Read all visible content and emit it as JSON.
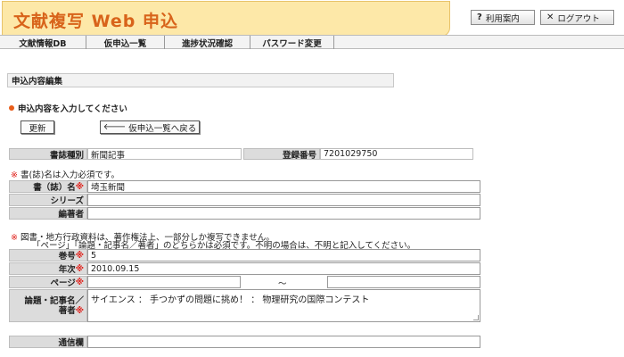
{
  "header": {
    "title": "文献複写 Web 申込"
  },
  "top_buttons": {
    "help": "利用案内",
    "logout": "ログアウト"
  },
  "menu": [
    "文献情報DB",
    "仮申込一覧",
    "進捗状況確認",
    "パスワード変更"
  ],
  "section_title": "申込内容編集",
  "instruction": "申込内容を入力してください",
  "buttons": {
    "update": "更新",
    "back": "仮申込一覧へ戻る"
  },
  "info": {
    "doc_type_label": "書誌種別",
    "doc_type_value": "新聞記事",
    "reg_no_label": "登録番号",
    "reg_no_value": "7201029750"
  },
  "notes": {
    "mark": "※",
    "required_title": "書(誌)名は入力必須です。",
    "copyright_1": "図書・地方行政資料は、著作権法上、一部分しか複写できません。",
    "copyright_2": "「ページ」「論題・記事名／著者」のどちらかは必須です。不明の場合は、不明と記入してください。"
  },
  "form": {
    "title_label": "書（誌）名",
    "title_value": "埼玉新聞",
    "series_label": "シリーズ",
    "series_value": "",
    "editor_label": "編著者",
    "editor_value": "",
    "volume_label": "巻号",
    "volume_value": "5",
    "year_label": "年次",
    "year_value": "2010.09.15",
    "page_label": "ページ",
    "page_from": "",
    "page_sep": "～",
    "page_to": "",
    "article_label_1": "論題・記事名／",
    "article_label_2": "著者",
    "article_value": "サイエンス ： 手つかずの問題に挑め！ ： 物理研究の国際コンテスト",
    "comm_label": "通信欄",
    "comm_value": ""
  }
}
